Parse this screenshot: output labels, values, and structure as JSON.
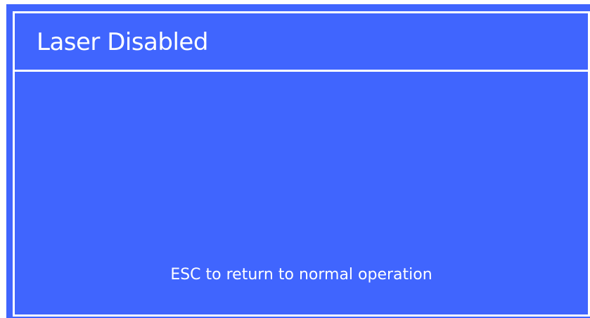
{
  "dialog": {
    "title": "Laser Disabled",
    "message": "ESC to return to normal operation"
  },
  "colors": {
    "background": "#4065fe",
    "text": "#ffffff",
    "border": "#ffffff",
    "page": "#ffffff"
  }
}
